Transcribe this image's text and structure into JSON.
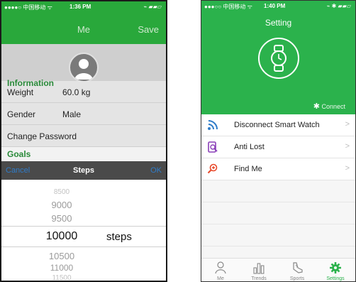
{
  "left_phone": {
    "status": {
      "carrier": "●●●●○ 中国移动 ᯤ",
      "time": "1:36 PM",
      "battery": "⌁ ▰▰▱"
    },
    "header": {
      "title": "Me",
      "save_label": "Save"
    },
    "sections": {
      "information": "Information",
      "goals": "Goals"
    },
    "rows": [
      {
        "label": "Weight",
        "value": "60.0 kg"
      },
      {
        "label": "Gender",
        "value": "Male"
      },
      {
        "label": "Change Password",
        "value": ""
      }
    ],
    "picker_bar": {
      "cancel": "Cancel",
      "title": "Steps",
      "ok": "OK"
    },
    "picker": {
      "options": [
        "8500",
        "9000",
        "9500",
        "10000",
        "10500",
        "11000",
        "11500"
      ],
      "selected": "10000",
      "unit": "steps"
    }
  },
  "right_phone": {
    "status": {
      "carrier": "●●●○○ 中国移动 ᯤ",
      "time": "1:40 PM",
      "battery": "⌁ ✱ ▰▰▱"
    },
    "header": {
      "title": "Setting",
      "connect_label": "Connect"
    },
    "menu": [
      {
        "label": "Disconnect Smart Watch",
        "icon": "signal-icon"
      },
      {
        "label": "Anti Lost",
        "icon": "phone-search-icon"
      },
      {
        "label": "Find Me",
        "icon": "magnifier-plus-icon"
      }
    ],
    "tabs": [
      {
        "label": "Me",
        "icon": "person-icon"
      },
      {
        "label": "Trends",
        "icon": "bar-chart-icon"
      },
      {
        "label": "Sports",
        "icon": "shoe-icon"
      },
      {
        "label": "Settings",
        "icon": "gear-icon"
      }
    ],
    "colors": {
      "green": "#2bb24c",
      "blue": "#2f7cc9"
    }
  }
}
